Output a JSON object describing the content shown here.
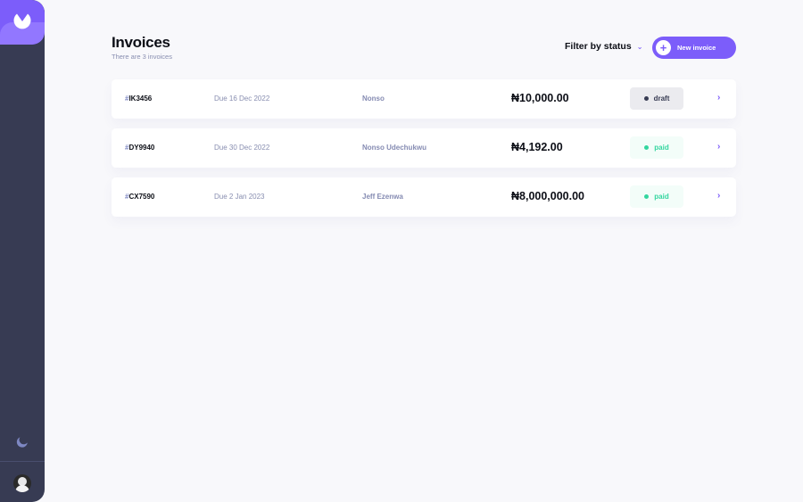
{
  "header": {
    "title": "Invoices",
    "subtitle": "There are 3 invoices",
    "filter_label": "Filter by status",
    "filter_icon": "chevron-down-icon",
    "new_invoice_label": "New invoice",
    "new_invoice_icon": "plus-icon"
  },
  "sidebar": {
    "logo_icon": "logo-icon",
    "theme_icon": "moon-icon",
    "avatar_icon": "avatar"
  },
  "invoices": [
    {
      "hash": "#",
      "id": "IK3456",
      "due": "Due 16 Dec 2022",
      "client": "Nonso",
      "amount": "₦10,000.00",
      "status": "draft"
    },
    {
      "hash": "#",
      "id": "DY9940",
      "due": "Due 30 Dec 2022",
      "client": "Nonso Udechukwu",
      "amount": "₦4,192.00",
      "status": "paid"
    },
    {
      "hash": "#",
      "id": "CX7590",
      "due": "Due 2 Jan 2023",
      "client": "Jeff Ezenwa",
      "amount": "₦8,000,000.00",
      "status": "paid"
    }
  ],
  "colors": {
    "accent": "#7c5dfa",
    "sidebar": "#373b53",
    "paid": "#33d69f",
    "draft": "#373b53",
    "background": "#f8f8fb"
  }
}
